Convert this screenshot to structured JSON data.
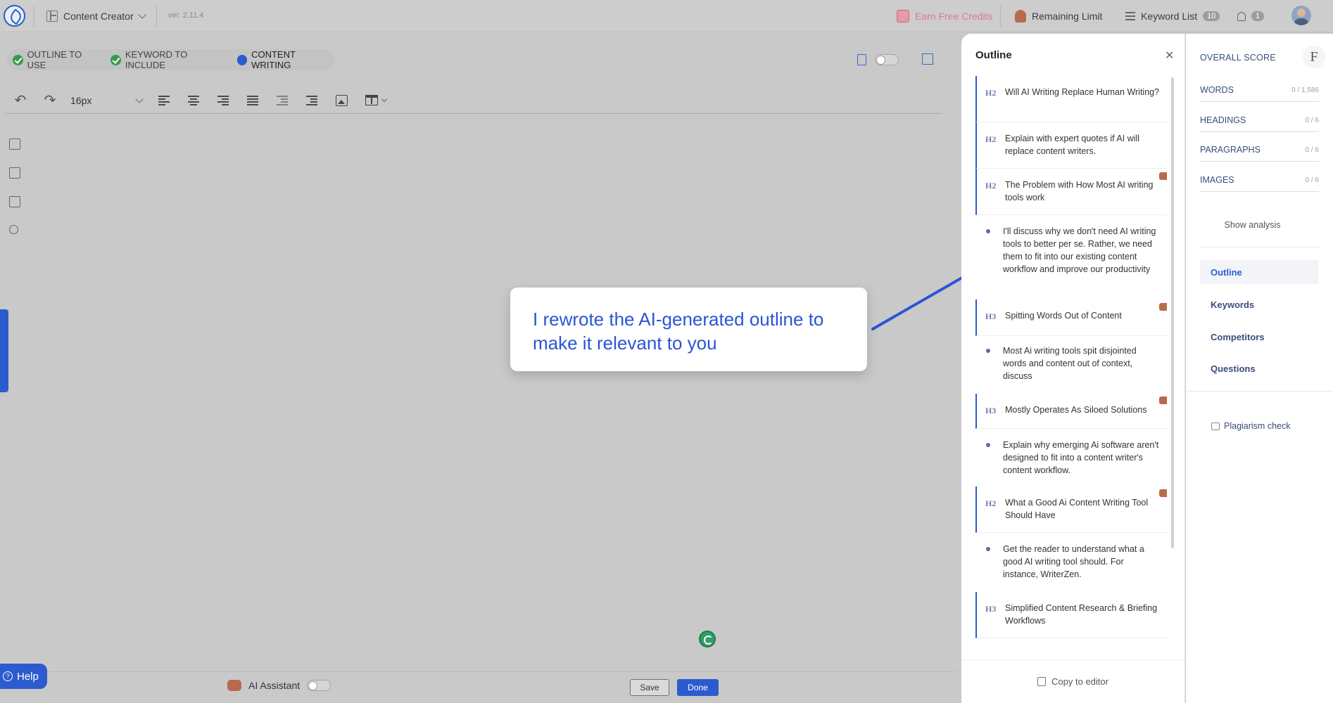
{
  "topbar": {
    "app_name": "Content Creator",
    "version": "ver. 2.11.4",
    "earn_credits": "Earn Free Credits",
    "remaining_limit": "Remaining Limit",
    "keyword_list": "Keyword List",
    "keyword_count": "10",
    "notification_count": "1"
  },
  "steps": [
    {
      "label": "OUTLINE TO USE",
      "state": "done"
    },
    {
      "label": "KEYWORD TO INCLUDE",
      "state": "done"
    },
    {
      "label": "CONTENT WRITING",
      "state": "active"
    }
  ],
  "toolbar": {
    "font_size": "16px"
  },
  "callout": {
    "text": "I rewrote the AI-generated outline to make it relevant to you"
  },
  "bottom": {
    "help": "Help",
    "ai_assistant": "AI Assistant",
    "save": "Save",
    "done": "Done"
  },
  "outline": {
    "title": "Outline",
    "copy_to_editor": "Copy to editor",
    "items": [
      {
        "type": "H2",
        "text": "Will AI Writing Replace Human Writing?",
        "ai": false
      },
      {
        "type": "H2",
        "text": "Explain with expert quotes if AI will replace content writers.",
        "ai": false
      },
      {
        "type": "H2",
        "text": "The Problem with How Most AI writing tools work",
        "ai": true
      },
      {
        "type": "para",
        "text": "I'll discuss why we don't need AI writing tools to better per se. Rather, we need them to fit into our existing content workflow and improve our productivity",
        "ai": false
      },
      {
        "type": "H3",
        "text": "Spitting Words Out of Content",
        "ai": true
      },
      {
        "type": "para",
        "text": "Most Ai writing tools spit disjointed words and content out of context, discuss",
        "ai": false
      },
      {
        "type": "H3",
        "text": "Mostly Operates As Siloed Solutions",
        "ai": true
      },
      {
        "type": "para",
        "text": "Explain why emerging Ai software aren't designed to fit into a content writer's content workflow.",
        "ai": false
      },
      {
        "type": "H2",
        "text": "What a Good Ai Content Writing Tool Should Have",
        "ai": true
      },
      {
        "type": "para",
        "text": "Get the reader to understand what a good AI writing tool should. For instance, WriterZen.",
        "ai": false
      },
      {
        "type": "H3",
        "text": "Simplified Content Research & Briefing Workflows",
        "ai": false
      }
    ]
  },
  "score": {
    "title": "OVERALL SCORE",
    "grade": "F",
    "metrics": [
      {
        "label": "WORDS",
        "value": "0 / 1,586"
      },
      {
        "label": "HEADINGS",
        "value": "0 / 6"
      },
      {
        "label": "PARAGRAPHS",
        "value": "0 / 6"
      },
      {
        "label": "IMAGES",
        "value": "0 / 6"
      }
    ],
    "show_analysis": "Show analysis",
    "nav": [
      "Outline",
      "Keywords",
      "Competitors",
      "Questions"
    ],
    "plagiarism": "Plagiarism check"
  }
}
